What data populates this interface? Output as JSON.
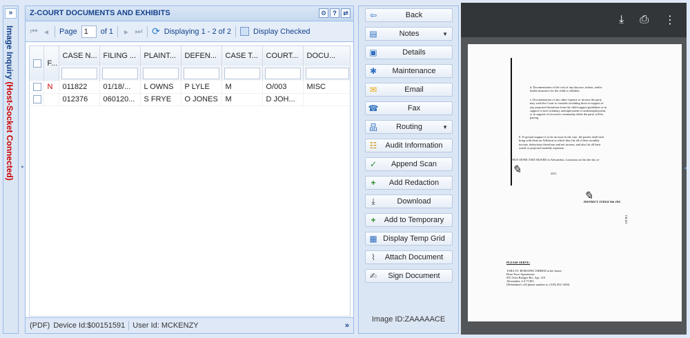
{
  "side_panel": {
    "title": "Image Inquiry",
    "status": "(Host-Socket Connected)",
    "expand_glyph": "»"
  },
  "docs_panel": {
    "title": "Z-COURT DOCUMENTS AND EXHIBITS",
    "tools": [
      "⚙",
      "?",
      "⇄"
    ],
    "pager": {
      "page_label": "Page",
      "page_value": "1",
      "of_label": "of 1",
      "displaying": "Displaying 1 - 2 of 2",
      "display_checked": "Display Checked"
    },
    "columns": [
      "F...",
      "CASE N...",
      "FILING ...",
      "PLAINT...",
      "DEFEN...",
      "CASE T...",
      "COURT...",
      "DOCU..."
    ],
    "rows": [
      {
        "flag": "N",
        "case": "011822",
        "filing": "01/18/...",
        "plaintiff": "L OWNS",
        "defendant": "P LYLE",
        "case_type": "M",
        "court": "O/003",
        "doc": "MISC"
      },
      {
        "flag": "",
        "case": "012376",
        "filing": "060120...",
        "plaintiff": "S FRYE",
        "defendant": "O JONES",
        "case_type": "M",
        "court": "D JOH...",
        "doc": ""
      }
    ],
    "footer": {
      "format": "(PDF)",
      "device": "Device Id:$00151591",
      "user": "User Id: MCKENZY",
      "more": "»"
    }
  },
  "actions": {
    "buttons": [
      {
        "label": "Back",
        "icon": "back-arrow-icon",
        "glyph": "⇦",
        "dropdown": false
      },
      {
        "label": "Notes",
        "icon": "notes-icon",
        "glyph": "▤",
        "dropdown": true
      },
      {
        "label": "Details",
        "icon": "details-icon",
        "glyph": "▣",
        "dropdown": false
      },
      {
        "label": "Maintenance",
        "icon": "maintenance-icon",
        "glyph": "✱",
        "dropdown": false
      },
      {
        "label": "Email",
        "icon": "email-icon",
        "glyph": "✉",
        "dropdown": false
      },
      {
        "label": "Fax",
        "icon": "fax-icon",
        "glyph": "☎",
        "dropdown": false
      },
      {
        "label": "Routing",
        "icon": "routing-icon",
        "glyph": "品",
        "dropdown": true
      },
      {
        "label": "Audit Information",
        "icon": "audit-icon",
        "glyph": "☷",
        "dropdown": false
      },
      {
        "label": "Append Scan",
        "icon": "append-scan-icon",
        "glyph": "✓",
        "dropdown": false
      },
      {
        "label": "Add Redaction",
        "icon": "add-redaction-icon",
        "glyph": "+",
        "dropdown": false
      },
      {
        "label": "Download",
        "icon": "download-icon",
        "glyph": "⤓",
        "dropdown": false
      },
      {
        "label": "Add to Temporary",
        "icon": "add-temporary-icon",
        "glyph": "+",
        "dropdown": false
      },
      {
        "label": "Display Temp Grid",
        "icon": "temp-grid-icon",
        "glyph": "▦",
        "dropdown": false
      },
      {
        "label": "Attach Document",
        "icon": "paperclip-icon",
        "glyph": "⌇",
        "dropdown": false
      },
      {
        "label": "Sign Document",
        "icon": "signature-icon",
        "glyph": "✍",
        "dropdown": false
      }
    ],
    "image_id": "Image ID:ZAAAAACE"
  },
  "viewer": {
    "toolbar_icons": [
      "download-icon",
      "print-icon",
      "more-vert-icon"
    ],
    "toolbar_glyphs": [
      "⤓",
      "⎙",
      "⋮"
    ],
    "page_text": {
      "item_a": "d. Documentation of the cost of any daycare, tuition, and/or health insurance for the child or children.",
      "item_b": "e. Documentation of any other expense or income the party may wish the Court to consider including those in support of any proposed deviations from the child support guidelines or in support of non-voluntary unemployment or underemployment, or in support of excessive community debts the party will be paying.",
      "item_c": "8. If spousal support is to be an issue in the case, the parties shall each bring with them an Affidavit in which they list all of their monthly income, deductions therefrom and net income, and also list all their actual or proposed monthly expenses.",
      "done": "THUS DONE AND SIGNED in Alexandria, Louisiana on this the",
      "day": "day of",
      "year": "2011.",
      "judge": "DISTRICT JUDGE 9th JDC",
      "please_serve": "PLEASE SERVE:",
      "serve_lines": [
        "TARA ST. ROMAINE JARRED at her home:",
        "Beau Terre Apartments",
        "835 Twin Bridges Rd., Apt. 118",
        "Alexandria, LA 71303",
        "(Defendant's cell phone number is: (318) 452-1260)"
      ]
    }
  }
}
